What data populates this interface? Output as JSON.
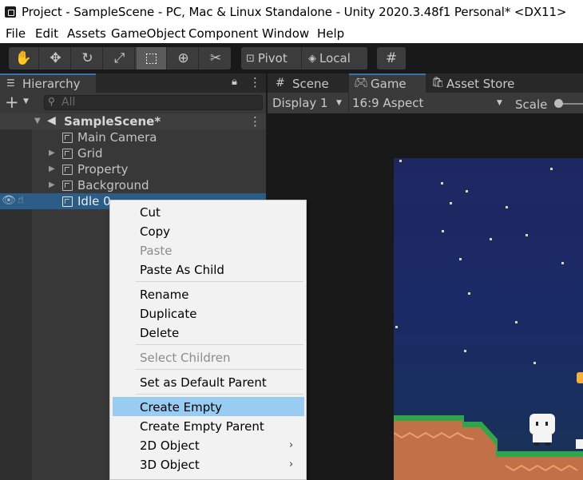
{
  "window": {
    "title": "Project - SampleScene - PC, Mac & Linux Standalone - Unity 2020.3.48f1 Personal* <DX11>"
  },
  "menubar": [
    "File",
    "Edit",
    "Assets",
    "GameObject",
    "Component",
    "Window",
    "Help"
  ],
  "toolbar": {
    "tools": [
      "hand-icon",
      "move-icon",
      "rotate-icon",
      "scale-icon",
      "rect-icon",
      "transform-icon",
      "custom-tool-icon"
    ],
    "active_tool": "rect-icon",
    "pivot_label": "Pivot",
    "local_label": "Local"
  },
  "hierarchy": {
    "tab_label": "Hierarchy",
    "search_placeholder": "All",
    "scene_name": "SampleScene*",
    "items": [
      {
        "label": "Main Camera",
        "foldable": false
      },
      {
        "label": "Grid",
        "foldable": true
      },
      {
        "label": "Property",
        "foldable": true
      },
      {
        "label": "Background",
        "foldable": true
      },
      {
        "label": "Idle 0",
        "foldable": false,
        "selected": true
      }
    ]
  },
  "tabs": {
    "scene": "Scene",
    "game": "Game",
    "asset_store": "Asset Store"
  },
  "game_toolbar": {
    "display": "Display 1",
    "aspect": "16:9 Aspect",
    "scale_label": "Scale"
  },
  "context_menu": {
    "items": [
      {
        "label": "Cut",
        "disabled": false
      },
      {
        "label": "Copy",
        "disabled": false
      },
      {
        "label": "Paste",
        "disabled": true
      },
      {
        "label": "Paste As Child",
        "disabled": false
      },
      {
        "label": "Rename",
        "disabled": false
      },
      {
        "label": "Duplicate",
        "disabled": false
      },
      {
        "label": "Delete",
        "disabled": false
      },
      {
        "label": "Select Children",
        "disabled": true
      },
      {
        "label": "Set as Default Parent",
        "disabled": false
      },
      {
        "label": "Create Empty",
        "disabled": false,
        "highlighted": true
      },
      {
        "label": "Create Empty Parent",
        "disabled": false
      },
      {
        "label": "2D Object",
        "disabled": false,
        "submenu": true
      },
      {
        "label": "3D Object",
        "disabled": false,
        "submenu": true
      }
    ]
  },
  "colors": {
    "selection": "#2c5d87",
    "menu_highlight": "#99ccf2",
    "grass": "#2f9e4a",
    "dirt": "#c0714a"
  }
}
